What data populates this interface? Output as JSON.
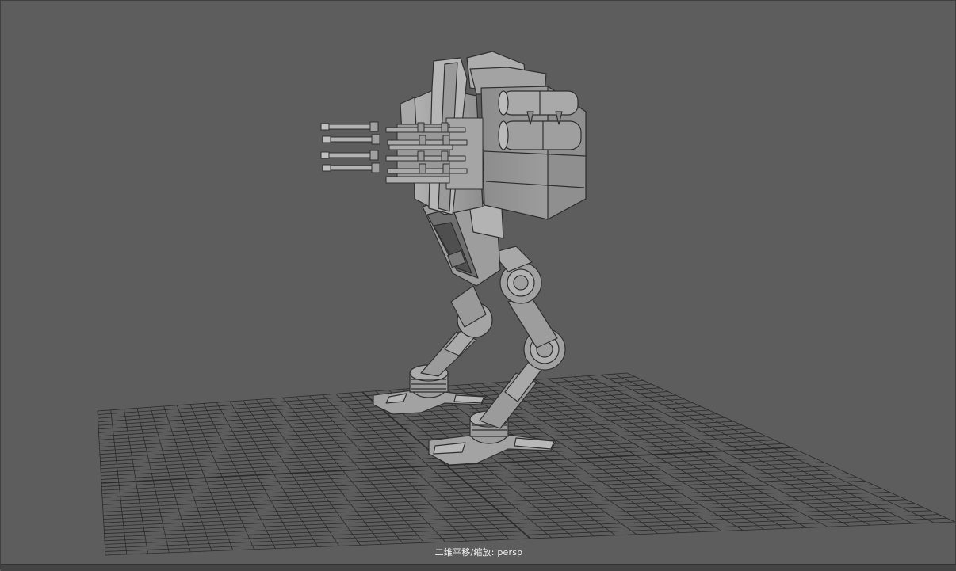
{
  "viewport": {
    "camera_label": "二维平移/缩放: persp",
    "background_color": "#5d5d5d",
    "grid_color": "#2a2a2a"
  },
  "scene": {
    "model": "mech-walker-robot",
    "model_color": "#9a9a9a",
    "edge_color": "#2f2f2f"
  }
}
